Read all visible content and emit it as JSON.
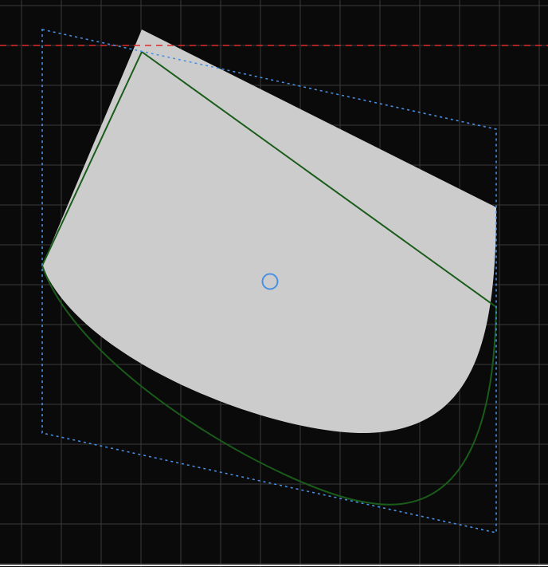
{
  "canvas": {
    "background_color": "#0a0a0a"
  },
  "grid": {
    "visible": true,
    "color": "#3a3a3a"
  },
  "guide_line": {
    "color": "#e02a2a",
    "style": "dashed"
  },
  "bounding_box": {
    "color": "#4a90e2",
    "style": "dotted"
  },
  "filled_shape": {
    "fill_color": "#d0d0d0"
  },
  "outline_path": {
    "color": "#1a5c1a"
  },
  "center_handle": {
    "icon": "circle-handle-icon",
    "color": "#4a90e2"
  },
  "bottom_edge": {
    "color": "#e6e6e6"
  }
}
